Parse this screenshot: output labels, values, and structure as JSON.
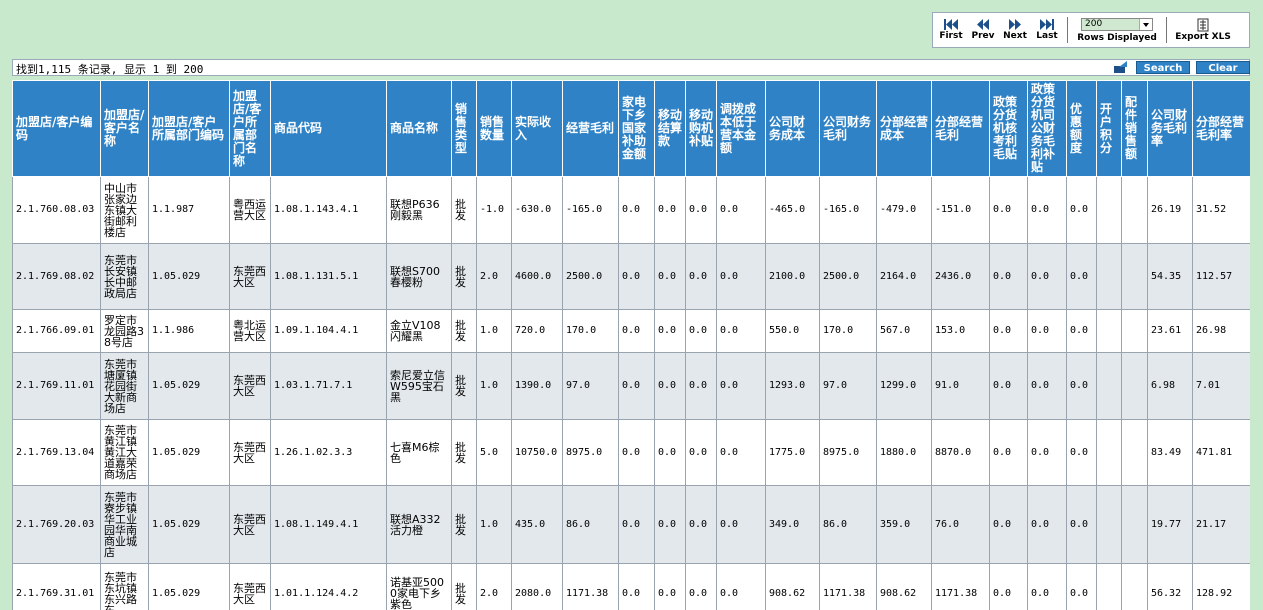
{
  "toolbar": {
    "first": "First",
    "prev": "Prev",
    "next": "Next",
    "last": "Last",
    "rows_value": "200",
    "rows_label": "Rows Displayed",
    "export": "Export XLS"
  },
  "summary": "找到1,115 条记录, 显示 1 到 200",
  "buttons": {
    "search": "Search",
    "clear": "Clear"
  },
  "columns": [
    "加盟店/客户编码",
    "加盟店/客户名称",
    "加盟店/客户所属部门编码",
    "加盟店/客户所属部门名称",
    "商品代码",
    "商品名称",
    "销售类型",
    "销售数量",
    "实际收入",
    "经营毛利",
    "家电下乡国家补助金额",
    "移动结算款",
    "移动购机补贴",
    "调拨成本低于营本金额",
    "公司财务成本",
    "公司财务毛利",
    "分部经营成本",
    "分部经营毛利",
    "政策分货机核考利毛贴",
    "政策分货机司公财务毛利补贴",
    "优惠额度",
    "开户积分",
    "配件销售额",
    "公司财务毛利率",
    "分部经营毛利率"
  ],
  "rows": [
    [
      "2.1.760.08.03",
      "中山市张家边东镇大街邮利楼店",
      "1.1.987",
      "粤西运营大区",
      "1.08.1.143.4.1",
      "联想P636刚毅黑",
      "批发",
      "-1.0",
      "-630.0",
      "-165.0",
      "0.0",
      "0.0",
      "0.0",
      "0.0",
      "-465.0",
      "-165.0",
      "-479.0",
      "-151.0",
      "0.0",
      "0.0",
      "0.0",
      "",
      "",
      "26.19",
      "31.52"
    ],
    [
      "2.1.769.08.02",
      "东莞市长安镇长中邮政局店",
      "1.05.029",
      "东莞西大区",
      "1.08.1.131.5.1",
      "联想S700春樱粉",
      "批发",
      "2.0",
      "4600.0",
      "2500.0",
      "0.0",
      "0.0",
      "0.0",
      "0.0",
      "2100.0",
      "2500.0",
      "2164.0",
      "2436.0",
      "0.0",
      "0.0",
      "0.0",
      "",
      "",
      "54.35",
      "112.57"
    ],
    [
      "2.1.766.09.01",
      "罗定市龙园路38号店",
      "1.1.986",
      "粤北运营大区",
      "1.09.1.104.4.1",
      "金立V108闪耀黑",
      "批发",
      "1.0",
      "720.0",
      "170.0",
      "0.0",
      "0.0",
      "0.0",
      "0.0",
      "550.0",
      "170.0",
      "567.0",
      "153.0",
      "0.0",
      "0.0",
      "0.0",
      "",
      "",
      "23.61",
      "26.98"
    ],
    [
      "2.1.769.11.01",
      "东莞市塘厦镇花园街大新商场店",
      "1.05.029",
      "东莞西大区",
      "1.03.1.71.7.1",
      "索尼爱立信W595宝石黑",
      "批发",
      "1.0",
      "1390.0",
      "97.0",
      "0.0",
      "0.0",
      "0.0",
      "0.0",
      "1293.0",
      "97.0",
      "1299.0",
      "91.0",
      "0.0",
      "0.0",
      "0.0",
      "",
      "",
      "6.98",
      "7.01"
    ],
    [
      "2.1.769.13.04",
      "东莞市黄江镇黄江大道嘉荣商场店",
      "1.05.029",
      "东莞西大区",
      "1.26.1.02.3.3",
      "七喜M6棕色",
      "批发",
      "5.0",
      "10750.0",
      "8975.0",
      "0.0",
      "0.0",
      "0.0",
      "0.0",
      "1775.0",
      "8975.0",
      "1880.0",
      "8870.0",
      "0.0",
      "0.0",
      "0.0",
      "",
      "",
      "83.49",
      "471.81"
    ],
    [
      "2.1.769.20.03",
      "东莞市寮步镇华工业园华南商业城店",
      "1.05.029",
      "东莞西大区",
      "1.08.1.149.4.1",
      "联想A332活力橙",
      "批发",
      "1.0",
      "435.0",
      "86.0",
      "0.0",
      "0.0",
      "0.0",
      "0.0",
      "349.0",
      "86.0",
      "359.0",
      "76.0",
      "0.0",
      "0.0",
      "0.0",
      "",
      "",
      "19.77",
      "21.17"
    ],
    [
      "2.1.769.31.01",
      "东莞市东坑镇东兴路东",
      "1.05.029",
      "东莞西大区",
      "1.01.1.124.4.2",
      "诺基亚5000家电下乡紫色",
      "批发",
      "2.0",
      "2080.0",
      "1171.38",
      "0.0",
      "0.0",
      "0.0",
      "0.0",
      "908.62",
      "1171.38",
      "908.62",
      "1171.38",
      "0.0",
      "0.0",
      "0.0",
      "",
      "",
      "56.32",
      "128.92"
    ]
  ],
  "row_heights": [
    67,
    66,
    43,
    67,
    66,
    78,
    60
  ]
}
